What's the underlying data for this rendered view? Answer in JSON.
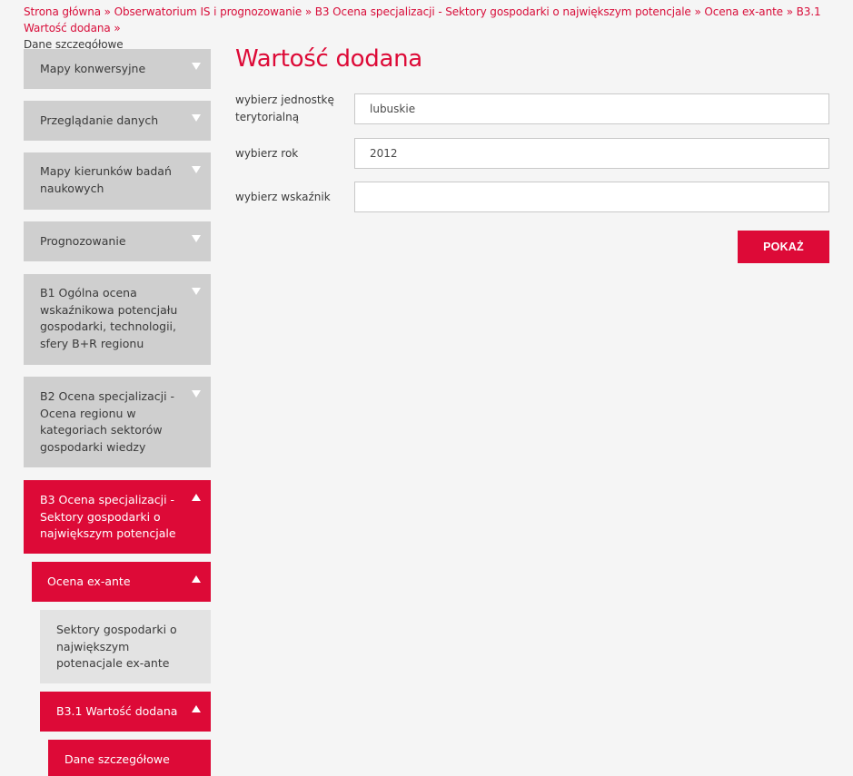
{
  "breadcrumb": {
    "items": [
      "Strona główna",
      "Obserwatorium IS i prognozowanie",
      "B3 Ocena specjalizacji - Sektory gospodarki o największym potencjale",
      "Ocena ex-ante",
      "B3.1 Wartość dodana"
    ],
    "separator": "»",
    "current": "Dane szczegółowe"
  },
  "sidebar": {
    "items": [
      {
        "label": "Mapy konwersyjne",
        "state": "collapsed"
      },
      {
        "label": "Przeglądanie danych",
        "state": "collapsed"
      },
      {
        "label": "Mapy kierunków badań naukowych",
        "state": "collapsed"
      },
      {
        "label": "Prognozowanie",
        "state": "collapsed"
      },
      {
        "label": "B1 Ogólna ocena wskaźnikowa potencjału gospodarki, technologii, sfery B+R regionu",
        "state": "collapsed"
      },
      {
        "label": "B2 Ocena specjalizacji - Ocena regionu w kategoriach sektorów gospodarki wiedzy",
        "state": "collapsed"
      },
      {
        "label": "B3 Ocena specjalizacji - Sektory gospodarki o największym potencjale",
        "state": "expanded"
      }
    ],
    "sub": {
      "ocena": {
        "label": "Ocena ex-ante",
        "state": "expanded"
      },
      "sektory": {
        "label": "Sektory gospodarki o największym potenacjale ex-ante"
      },
      "b31": {
        "label": "B3.1 Wartość dodana",
        "state": "expanded"
      },
      "dane": {
        "label": "Dane szczegółowe"
      }
    }
  },
  "main": {
    "title": "Wartość dodana",
    "fields": [
      {
        "label": "wybierz jednostkę terytorialną",
        "value": "lubuskie"
      },
      {
        "label": "wybierz rok",
        "value": "2012"
      },
      {
        "label": "wybierz wskaźnik",
        "value": ""
      }
    ],
    "submit_label": "POKAŻ"
  },
  "colors": {
    "accent": "#dd0a37",
    "nav_gray": "#cfcfcf",
    "nav_light": "#e3e3e3",
    "background": "#f5f5f5"
  }
}
